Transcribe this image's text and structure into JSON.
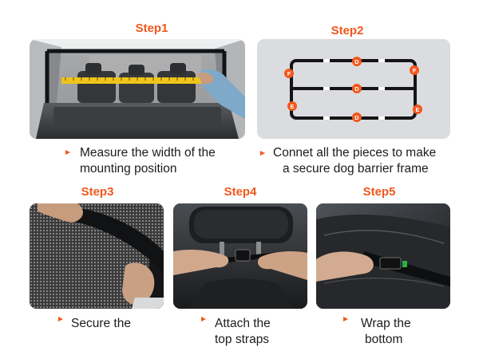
{
  "accent_color": "#f2571c",
  "steps": [
    {
      "title": "Step1",
      "caption_lines": [
        "Measure the width of the",
        "mounting position"
      ],
      "photo": "car-trunk-measuring-tape-photo"
    },
    {
      "title": "Step2",
      "caption_lines": [
        "Connet all the pieces to make",
        "a secure dog barrier frame"
      ],
      "photo": "barrier-frame-diagram",
      "frame_labels": [
        "D",
        "D",
        "D",
        "F",
        "F",
        "E",
        "E"
      ]
    },
    {
      "title": "Step3",
      "caption_lines": [
        "Secure the"
      ],
      "photo": "mesh-net-edge-photo"
    },
    {
      "title": "Step4",
      "caption_lines": [
        "Attach the",
        "top straps"
      ],
      "photo": "headrest-strap-buckle-photo"
    },
    {
      "title": "Step5",
      "caption_lines": [
        "Wrap the",
        "bottom"
      ],
      "photo": "seat-bottom-strap-photo"
    }
  ]
}
